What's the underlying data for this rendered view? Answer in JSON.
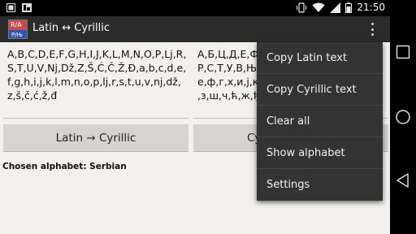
{
  "status_bar": {
    "time": "21:50"
  },
  "action_bar": {
    "title": "Latin ↔ Cyrillic",
    "icon_top": "R/A",
    "icon_bottom": "P/Њ"
  },
  "latin_text": "A,B,C,D,E,F,G,H,I,J,K,L,M,N,O,P,Lj,R,S,T,U,V,Nj,Dž,Z,Š,Ć,Č,Ž,Đ,a,b,c,d,e,f,g,h,i,j,k,l,m,n,o,p,lj,r,s,t,u,v,nj,dž,z,š,č,ć,ž,đ",
  "cyrillic_text_lines": [
    "А,Б,Ц,Д,Е,Ф",
    "Р,С,Т,У,В,Њ,",
    "е,ф,г,х,и,ј,к,",
    ",з,ш,ч,ћ,ж,ђ"
  ],
  "buttons": {
    "latin_to_cyrillic": "Latin → Cyrillic",
    "cyrillic_to_latin_visible": "Cy"
  },
  "chosen_alphabet": "Chosen alphabet: Serbian",
  "menu": {
    "items": [
      "Copy Latin text",
      "Copy Cyrillic text",
      "Clear all",
      "Show alphabet",
      "Settings"
    ]
  },
  "icons": {
    "status_left": [
      "notification-icon",
      "gallery-icon"
    ],
    "status_right": [
      "vibrate-icon",
      "wifi-icon",
      "signal-icon",
      "battery-icon"
    ],
    "nav": [
      "recents-icon",
      "home-icon",
      "back-icon"
    ]
  }
}
